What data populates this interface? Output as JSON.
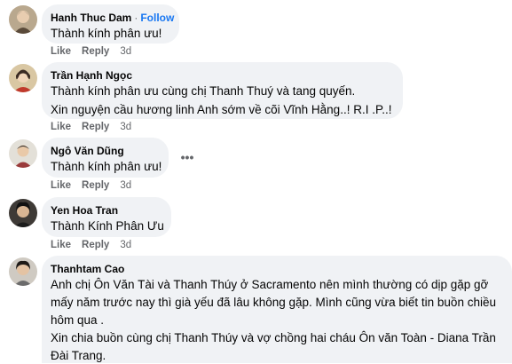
{
  "comments": [
    {
      "author": "Hanh Thuc Dam",
      "follow_label": "Follow",
      "lines": [
        "Thành kính phân ưu!"
      ],
      "like_label": "Like",
      "reply_label": "Reply",
      "time": "3d"
    },
    {
      "author": "Trần Hạnh Ngọc",
      "lines": [
        "Thành kính phân ưu cùng chị Thanh Thuý và tang quyến.",
        "Xin nguyện cầu hương linh Anh sớm về cõi Vĩnh Hằng..! R.I .P..!"
      ],
      "like_label": "Like",
      "reply_label": "Reply",
      "time": "3d"
    },
    {
      "author": "Ngô Văn Dũng",
      "lines": [
        "Thành kính phân ưu!"
      ],
      "more_label": "•••",
      "like_label": "Like",
      "reply_label": "Reply",
      "time": "3d"
    },
    {
      "author": "Yen Hoa Tran",
      "lines": [
        "Thành Kính Phân Ưu"
      ],
      "like_label": "Like",
      "reply_label": "Reply",
      "time": "3d"
    },
    {
      "author": "Thanhtam Cao",
      "lines": [
        "Anh chị Ôn Văn Tài và Thanh Thúy ở Sacramento nên mình thường có dịp gặp gỡ",
        "mấy năm trước nay thì già yếu đã lâu không gặp. Mình cũng vừa biết tin buồn chiều",
        "hôm qua .",
        "Xin chia buồn cùng chị Thanh Thúy và vợ chồng hai cháu Ôn văn Toàn - Diana Trần",
        "Đài Trang."
      ]
    }
  ]
}
